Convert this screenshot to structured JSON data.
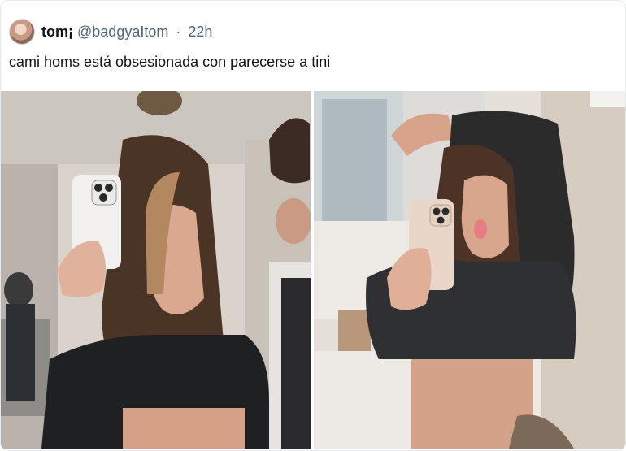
{
  "tweet": {
    "display_name": "tom¡",
    "handle": "@badgyaItom",
    "separator": "·",
    "timestamp": "22h",
    "text": "cami homs está obsesionada con parecerse a tini"
  },
  "media": {
    "photos": [
      {
        "label": "Photo 1"
      },
      {
        "label": "Photo 2"
      }
    ]
  },
  "colors": {
    "text_primary": "#0f1419",
    "text_secondary": "#536471",
    "card_border": "#e6e9ec"
  },
  "icons": {
    "avatar": "profile-avatar"
  }
}
